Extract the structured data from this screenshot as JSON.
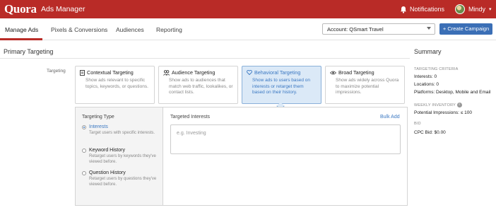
{
  "topbar": {
    "logo": "Quora",
    "app_name": "Ads Manager",
    "notifications_label": "Notifications",
    "user_name": "Mindy",
    "caret": "▾"
  },
  "nav": {
    "items": [
      "Manage Ads",
      "Pixels & Conversions",
      "Audiences",
      "Reporting"
    ],
    "active": "Manage Ads",
    "account_label": "Account: QSmart Travel",
    "create_button": "+ Create Campaign"
  },
  "primary_targeting": {
    "title": "Primary Targeting",
    "row_label": "Targeting",
    "cards": [
      {
        "title": "Contextual Targeting",
        "icon": "document-icon",
        "desc": "Show ads relevant to specific topics, keywords, or questions.",
        "selected": false
      },
      {
        "title": "Audience Targeting",
        "icon": "people-icon",
        "desc": "Show ads to audiences that match web traffic, lookalikes, or contact lists.",
        "selected": false
      },
      {
        "title": "Behavioral Targeting",
        "icon": "heart-icon",
        "desc": "Show ads to users based on interests or retarget them based on their history.",
        "selected": true
      },
      {
        "title": "Broad Targeting",
        "icon": "eye-icon",
        "desc": "Show ads widely across Quora to maximize potential impressions.",
        "selected": false
      }
    ]
  },
  "behavioral": {
    "type_label": "Targeting Type",
    "options": [
      {
        "title": "Interests",
        "desc": "Target users with specific interests.",
        "selected": true
      },
      {
        "title": "Keyword History",
        "desc": "Retarget users by keywords they've viewed before.",
        "selected": false
      },
      {
        "title": "Question History",
        "desc": "Retarget users by questions they've viewed before.",
        "selected": false
      }
    ],
    "interests_label": "Targeted Interests",
    "bulk_add": "Bulk Add",
    "input_placeholder": "e.g. Investing"
  },
  "summary": {
    "title": "Summary",
    "criteria_caption": "TARGETING CRITERIA",
    "interests": "Interests: 0",
    "locations": "Locations: 0",
    "platforms": "Platforms: Desktop, Mobile and Email",
    "inventory_caption": "WEEKLY INVENTORY",
    "potential": "Potential Impressions: ≤ 100",
    "bid_caption": "BID",
    "cpc_bid": "CPC Bid: $0.00"
  },
  "colors": {
    "brand": "#b92b27",
    "accent": "#3b78c2",
    "selected_bg": "#dbe9f7"
  }
}
